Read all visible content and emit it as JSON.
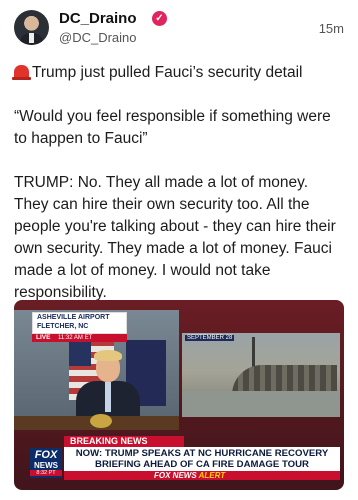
{
  "post": {
    "author_name": "DC_Draino",
    "verified_icon": "verified-badge-icon",
    "handle": "@DC_Draino",
    "timestamp": "15m",
    "accent_color": "#e0245e",
    "paragraphs": [
      "Trump just pulled Fauci’s security detail",
      "“Would you feel responsible if something were to happen to Fauci”",
      "TRUMP: No. They all made a lot of money. They can hire their own security too. All the people you're talking about - they can hire their own security. They made a lot of money. Fauci made a lot of money. I would not take responsibility."
    ],
    "lead_icon": "rotating-light-icon"
  },
  "media": {
    "location_line1": "ASHEVILLE AIRPORT",
    "location_line2": "FLETCHER, NC",
    "live_label": "LIVE",
    "live_time": "11:32 AM ET",
    "inset_date": "SEPTEMBER 28",
    "breaking_label": "BREAKING NEWS",
    "headline": "NOW: TRUMP SPEAKS AT NC HURRICANE RECOVERY BRIEFING AHEAD OF CA FIRE DAMAGE TOUR",
    "alert_brand": "FOX NEWS",
    "alert_word": "ALERT",
    "logo_fox": "FOX",
    "logo_news": "NEWS",
    "logo_time": "8:32 PT"
  }
}
